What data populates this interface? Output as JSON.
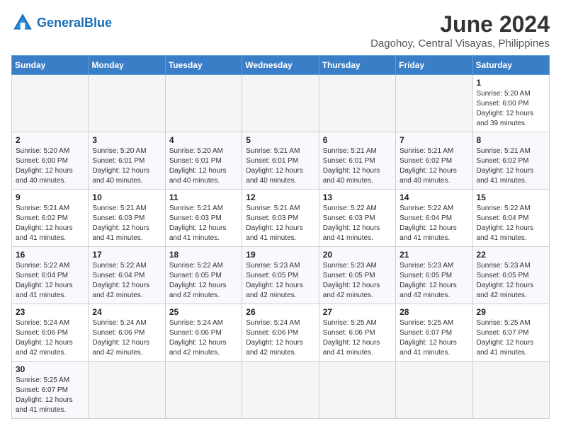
{
  "logo": {
    "text_general": "General",
    "text_blue": "Blue"
  },
  "title": "June 2024",
  "subtitle": "Dagohoy, Central Visayas, Philippines",
  "headers": [
    "Sunday",
    "Monday",
    "Tuesday",
    "Wednesday",
    "Thursday",
    "Friday",
    "Saturday"
  ],
  "weeks": [
    [
      {
        "day": "",
        "info": "",
        "empty": true
      },
      {
        "day": "",
        "info": "",
        "empty": true
      },
      {
        "day": "",
        "info": "",
        "empty": true
      },
      {
        "day": "",
        "info": "",
        "empty": true
      },
      {
        "day": "",
        "info": "",
        "empty": true
      },
      {
        "day": "",
        "info": "",
        "empty": true
      },
      {
        "day": "1",
        "info": "Sunrise: 5:20 AM\nSunset: 6:00 PM\nDaylight: 12 hours\nand 39 minutes.",
        "empty": false
      }
    ],
    [
      {
        "day": "2",
        "info": "Sunrise: 5:20 AM\nSunset: 6:00 PM\nDaylight: 12 hours\nand 40 minutes.",
        "empty": false
      },
      {
        "day": "3",
        "info": "Sunrise: 5:20 AM\nSunset: 6:01 PM\nDaylight: 12 hours\nand 40 minutes.",
        "empty": false
      },
      {
        "day": "4",
        "info": "Sunrise: 5:20 AM\nSunset: 6:01 PM\nDaylight: 12 hours\nand 40 minutes.",
        "empty": false
      },
      {
        "day": "5",
        "info": "Sunrise: 5:21 AM\nSunset: 6:01 PM\nDaylight: 12 hours\nand 40 minutes.",
        "empty": false
      },
      {
        "day": "6",
        "info": "Sunrise: 5:21 AM\nSunset: 6:01 PM\nDaylight: 12 hours\nand 40 minutes.",
        "empty": false
      },
      {
        "day": "7",
        "info": "Sunrise: 5:21 AM\nSunset: 6:02 PM\nDaylight: 12 hours\nand 40 minutes.",
        "empty": false
      },
      {
        "day": "8",
        "info": "Sunrise: 5:21 AM\nSunset: 6:02 PM\nDaylight: 12 hours\nand 41 minutes.",
        "empty": false
      }
    ],
    [
      {
        "day": "9",
        "info": "Sunrise: 5:21 AM\nSunset: 6:02 PM\nDaylight: 12 hours\nand 41 minutes.",
        "empty": false
      },
      {
        "day": "10",
        "info": "Sunrise: 5:21 AM\nSunset: 6:03 PM\nDaylight: 12 hours\nand 41 minutes.",
        "empty": false
      },
      {
        "day": "11",
        "info": "Sunrise: 5:21 AM\nSunset: 6:03 PM\nDaylight: 12 hours\nand 41 minutes.",
        "empty": false
      },
      {
        "day": "12",
        "info": "Sunrise: 5:21 AM\nSunset: 6:03 PM\nDaylight: 12 hours\nand 41 minutes.",
        "empty": false
      },
      {
        "day": "13",
        "info": "Sunrise: 5:22 AM\nSunset: 6:03 PM\nDaylight: 12 hours\nand 41 minutes.",
        "empty": false
      },
      {
        "day": "14",
        "info": "Sunrise: 5:22 AM\nSunset: 6:04 PM\nDaylight: 12 hours\nand 41 minutes.",
        "empty": false
      },
      {
        "day": "15",
        "info": "Sunrise: 5:22 AM\nSunset: 6:04 PM\nDaylight: 12 hours\nand 41 minutes.",
        "empty": false
      }
    ],
    [
      {
        "day": "16",
        "info": "Sunrise: 5:22 AM\nSunset: 6:04 PM\nDaylight: 12 hours\nand 41 minutes.",
        "empty": false
      },
      {
        "day": "17",
        "info": "Sunrise: 5:22 AM\nSunset: 6:04 PM\nDaylight: 12 hours\nand 42 minutes.",
        "empty": false
      },
      {
        "day": "18",
        "info": "Sunrise: 5:22 AM\nSunset: 6:05 PM\nDaylight: 12 hours\nand 42 minutes.",
        "empty": false
      },
      {
        "day": "19",
        "info": "Sunrise: 5:23 AM\nSunset: 6:05 PM\nDaylight: 12 hours\nand 42 minutes.",
        "empty": false
      },
      {
        "day": "20",
        "info": "Sunrise: 5:23 AM\nSunset: 6:05 PM\nDaylight: 12 hours\nand 42 minutes.",
        "empty": false
      },
      {
        "day": "21",
        "info": "Sunrise: 5:23 AM\nSunset: 6:05 PM\nDaylight: 12 hours\nand 42 minutes.",
        "empty": false
      },
      {
        "day": "22",
        "info": "Sunrise: 5:23 AM\nSunset: 6:05 PM\nDaylight: 12 hours\nand 42 minutes.",
        "empty": false
      }
    ],
    [
      {
        "day": "23",
        "info": "Sunrise: 5:24 AM\nSunset: 6:06 PM\nDaylight: 12 hours\nand 42 minutes.",
        "empty": false
      },
      {
        "day": "24",
        "info": "Sunrise: 5:24 AM\nSunset: 6:06 PM\nDaylight: 12 hours\nand 42 minutes.",
        "empty": false
      },
      {
        "day": "25",
        "info": "Sunrise: 5:24 AM\nSunset: 6:06 PM\nDaylight: 12 hours\nand 42 minutes.",
        "empty": false
      },
      {
        "day": "26",
        "info": "Sunrise: 5:24 AM\nSunset: 6:06 PM\nDaylight: 12 hours\nand 42 minutes.",
        "empty": false
      },
      {
        "day": "27",
        "info": "Sunrise: 5:25 AM\nSunset: 6:06 PM\nDaylight: 12 hours\nand 41 minutes.",
        "empty": false
      },
      {
        "day": "28",
        "info": "Sunrise: 5:25 AM\nSunset: 6:07 PM\nDaylight: 12 hours\nand 41 minutes.",
        "empty": false
      },
      {
        "day": "29",
        "info": "Sunrise: 5:25 AM\nSunset: 6:07 PM\nDaylight: 12 hours\nand 41 minutes.",
        "empty": false
      }
    ],
    [
      {
        "day": "30",
        "info": "Sunrise: 5:25 AM\nSunset: 6:07 PM\nDaylight: 12 hours\nand 41 minutes.",
        "empty": false
      },
      {
        "day": "",
        "info": "",
        "empty": true
      },
      {
        "day": "",
        "info": "",
        "empty": true
      },
      {
        "day": "",
        "info": "",
        "empty": true
      },
      {
        "day": "",
        "info": "",
        "empty": true
      },
      {
        "day": "",
        "info": "",
        "empty": true
      },
      {
        "day": "",
        "info": "",
        "empty": true
      }
    ]
  ]
}
